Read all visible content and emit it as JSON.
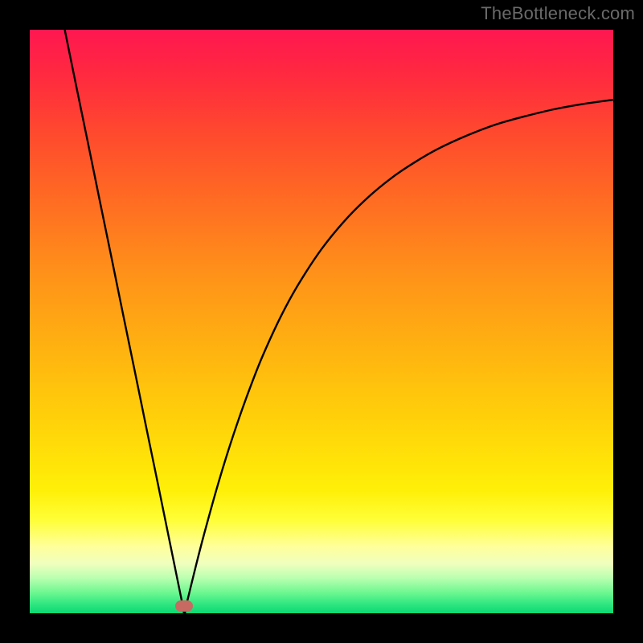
{
  "watermark": {
    "text": "TheBottleneck.com"
  },
  "colors": {
    "black": "#000000",
    "curve": "#000000",
    "marker": "#c76a62"
  },
  "gradient_stops": [
    {
      "offset": 0.0,
      "color": "#ff1750"
    },
    {
      "offset": 0.08,
      "color": "#ff2a3f"
    },
    {
      "offset": 0.18,
      "color": "#ff4a2d"
    },
    {
      "offset": 0.3,
      "color": "#ff6e22"
    },
    {
      "offset": 0.42,
      "color": "#ff9219"
    },
    {
      "offset": 0.55,
      "color": "#ffb310"
    },
    {
      "offset": 0.68,
      "color": "#ffd409"
    },
    {
      "offset": 0.79,
      "color": "#fff008"
    },
    {
      "offset": 0.84,
      "color": "#fffe37"
    },
    {
      "offset": 0.885,
      "color": "#ffff9a"
    },
    {
      "offset": 0.915,
      "color": "#f0ffbe"
    },
    {
      "offset": 0.94,
      "color": "#b9ffb0"
    },
    {
      "offset": 0.965,
      "color": "#6cf790"
    },
    {
      "offset": 0.985,
      "color": "#2de680"
    },
    {
      "offset": 1.0,
      "color": "#0bd874"
    }
  ],
  "chart_data": {
    "type": "line",
    "title": "",
    "xlabel": "",
    "ylabel": "",
    "xlim": [
      0,
      100
    ],
    "ylim": [
      0,
      100
    ],
    "grid": false,
    "minimum_x": 26.5,
    "marker_point": {
      "x": 26.5,
      "y": 1.2
    },
    "series": [
      {
        "name": "curve",
        "x": [
          6,
          8,
          10,
          12,
          14,
          16,
          18,
          20,
          22,
          24,
          25,
          26,
          26.5,
          27,
          28,
          29,
          30,
          32,
          34,
          36,
          38,
          40,
          43,
          46,
          50,
          54,
          58,
          62,
          66,
          70,
          75,
          80,
          85,
          90,
          95,
          100
        ],
        "y": [
          100,
          90.2,
          80.5,
          70.7,
          61.0,
          51.2,
          41.5,
          31.7,
          22.0,
          12.2,
          7.3,
          2.4,
          0.0,
          2.1,
          6.2,
          10.2,
          14.0,
          21.2,
          27.8,
          33.8,
          39.3,
          44.3,
          50.8,
          56.3,
          62.4,
          67.3,
          71.3,
          74.6,
          77.3,
          79.6,
          81.9,
          83.8,
          85.2,
          86.4,
          87.3,
          88.0
        ]
      }
    ]
  }
}
